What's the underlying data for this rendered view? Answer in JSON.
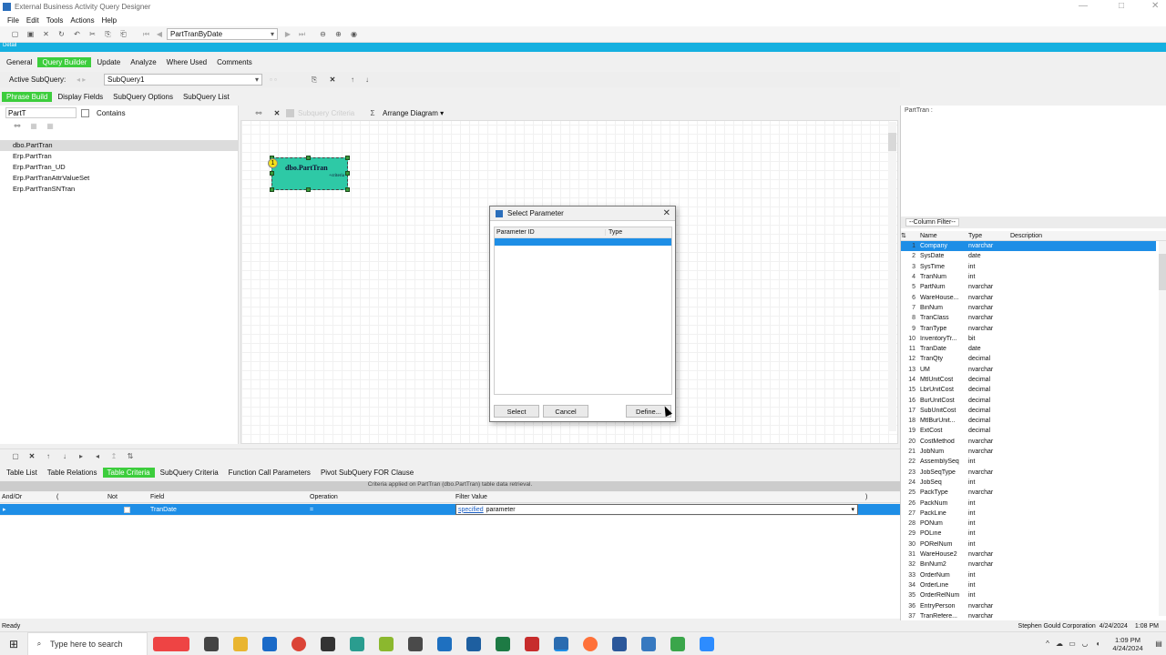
{
  "app": {
    "title": "External Business Activity Query Designer",
    "menu": [
      "File",
      "Edit",
      "Tools",
      "Actions",
      "Help"
    ],
    "query_name": "PartTranByDate",
    "detail_label": "Detail"
  },
  "top_tabs": [
    {
      "label": "General",
      "active": false
    },
    {
      "label": "Query Builder",
      "active": true
    },
    {
      "label": "Update",
      "active": false
    },
    {
      "label": "Analyze",
      "active": false
    },
    {
      "label": "Where Used",
      "active": false
    },
    {
      "label": "Comments",
      "active": false
    }
  ],
  "subquery": {
    "label": "Active SubQuery:",
    "value": "SubQuery1"
  },
  "sub_tabs": [
    {
      "label": "Phrase Build",
      "active": true
    },
    {
      "label": "Display Fields",
      "active": false
    },
    {
      "label": "SubQuery Options",
      "active": false
    },
    {
      "label": "SubQuery List",
      "active": false
    }
  ],
  "left_pane": {
    "search_value": "PartT",
    "contains_label": "Contains",
    "items": [
      "dbo.PartTran",
      "Erp.PartTran",
      "Erp.PartTran_UD",
      "Erp.PartTranAttrValueSet",
      "Erp.PartTranSNTran"
    ],
    "selected_index": 0
  },
  "canvas": {
    "toolbar_disabled": "Subquery Criteria",
    "arrange": "Arrange Diagram",
    "table_node": {
      "name": "dbo.PartTran",
      "subtitle": "+criteria",
      "badge": "1"
    }
  },
  "dialog": {
    "title": "Select Parameter",
    "columns": [
      "Parameter ID",
      "Type"
    ],
    "buttons": {
      "select": "Select",
      "cancel": "Cancel",
      "define": "Define..."
    }
  },
  "right_pane": {
    "header": "PartTran :",
    "filter_label": "--Column Filter--",
    "columns": [
      "Name",
      "Type",
      "Description"
    ],
    "rows": [
      {
        "n": "1",
        "name": "Company",
        "type": "nvarchar"
      },
      {
        "n": "2",
        "name": "SysDate",
        "type": "date"
      },
      {
        "n": "3",
        "name": "SysTime",
        "type": "int"
      },
      {
        "n": "4",
        "name": "TranNum",
        "type": "int"
      },
      {
        "n": "5",
        "name": "PartNum",
        "type": "nvarchar"
      },
      {
        "n": "6",
        "name": "WareHouse...",
        "type": "nvarchar"
      },
      {
        "n": "7",
        "name": "BinNum",
        "type": "nvarchar"
      },
      {
        "n": "8",
        "name": "TranClass",
        "type": "nvarchar"
      },
      {
        "n": "9",
        "name": "TranType",
        "type": "nvarchar"
      },
      {
        "n": "10",
        "name": "InventoryTr...",
        "type": "bit"
      },
      {
        "n": "11",
        "name": "TranDate",
        "type": "date"
      },
      {
        "n": "12",
        "name": "TranQty",
        "type": "decimal"
      },
      {
        "n": "13",
        "name": "UM",
        "type": "nvarchar"
      },
      {
        "n": "14",
        "name": "MtlUnitCost",
        "type": "decimal"
      },
      {
        "n": "15",
        "name": "LbrUnitCost",
        "type": "decimal"
      },
      {
        "n": "16",
        "name": "BurUnitCost",
        "type": "decimal"
      },
      {
        "n": "17",
        "name": "SubUnitCost",
        "type": "decimal"
      },
      {
        "n": "18",
        "name": "MtlBurUnit...",
        "type": "decimal"
      },
      {
        "n": "19",
        "name": "ExtCost",
        "type": "decimal"
      },
      {
        "n": "20",
        "name": "CostMethod",
        "type": "nvarchar"
      },
      {
        "n": "21",
        "name": "JobNum",
        "type": "nvarchar"
      },
      {
        "n": "22",
        "name": "AssemblySeq",
        "type": "int"
      },
      {
        "n": "23",
        "name": "JobSeqType",
        "type": "nvarchar"
      },
      {
        "n": "24",
        "name": "JobSeq",
        "type": "int"
      },
      {
        "n": "25",
        "name": "PackType",
        "type": "nvarchar"
      },
      {
        "n": "26",
        "name": "PackNum",
        "type": "int"
      },
      {
        "n": "27",
        "name": "PackLine",
        "type": "int"
      },
      {
        "n": "28",
        "name": "PONum",
        "type": "int"
      },
      {
        "n": "29",
        "name": "POLine",
        "type": "int"
      },
      {
        "n": "30",
        "name": "PORelNum",
        "type": "int"
      },
      {
        "n": "31",
        "name": "WareHouse2",
        "type": "nvarchar"
      },
      {
        "n": "32",
        "name": "BinNum2",
        "type": "nvarchar"
      },
      {
        "n": "33",
        "name": "OrderNum",
        "type": "int"
      },
      {
        "n": "34",
        "name": "OrderLine",
        "type": "int"
      },
      {
        "n": "35",
        "name": "OrderRelNum",
        "type": "int"
      },
      {
        "n": "36",
        "name": "EntryPerson",
        "type": "nvarchar"
      },
      {
        "n": "37",
        "name": "TranRefere...",
        "type": "nvarchar"
      }
    ]
  },
  "bottom_tabs": [
    {
      "label": "Table List",
      "active": false
    },
    {
      "label": "Table Relations",
      "active": false
    },
    {
      "label": "Table Criteria",
      "active": true
    },
    {
      "label": "SubQuery Criteria",
      "active": false
    },
    {
      "label": "Function Call Parameters",
      "active": false
    },
    {
      "label": "Pivot SubQuery FOR Clause",
      "active": false
    }
  ],
  "criteria": {
    "header": "Criteria applied on PartTran (dbo.PartTran) table data retrieval.",
    "columns": {
      "andor": "And/Or",
      "paren_open": "(",
      "not": "Not",
      "field": "Field",
      "operation": "Operation",
      "filter": "Filter Value",
      "paren_close": ")"
    },
    "row": {
      "field": "TranDate",
      "operation": "=",
      "filter_link": "specified",
      "filter_text": "parameter"
    }
  },
  "status": {
    "left": "Ready",
    "company": "Stephen Gould Corporation",
    "date": "4/24/2024",
    "time": "1:08 PM"
  },
  "taskbar": {
    "search_placeholder": "Type here to search",
    "clock_time": "1:09 PM",
    "clock_date": "4/24/2024"
  }
}
